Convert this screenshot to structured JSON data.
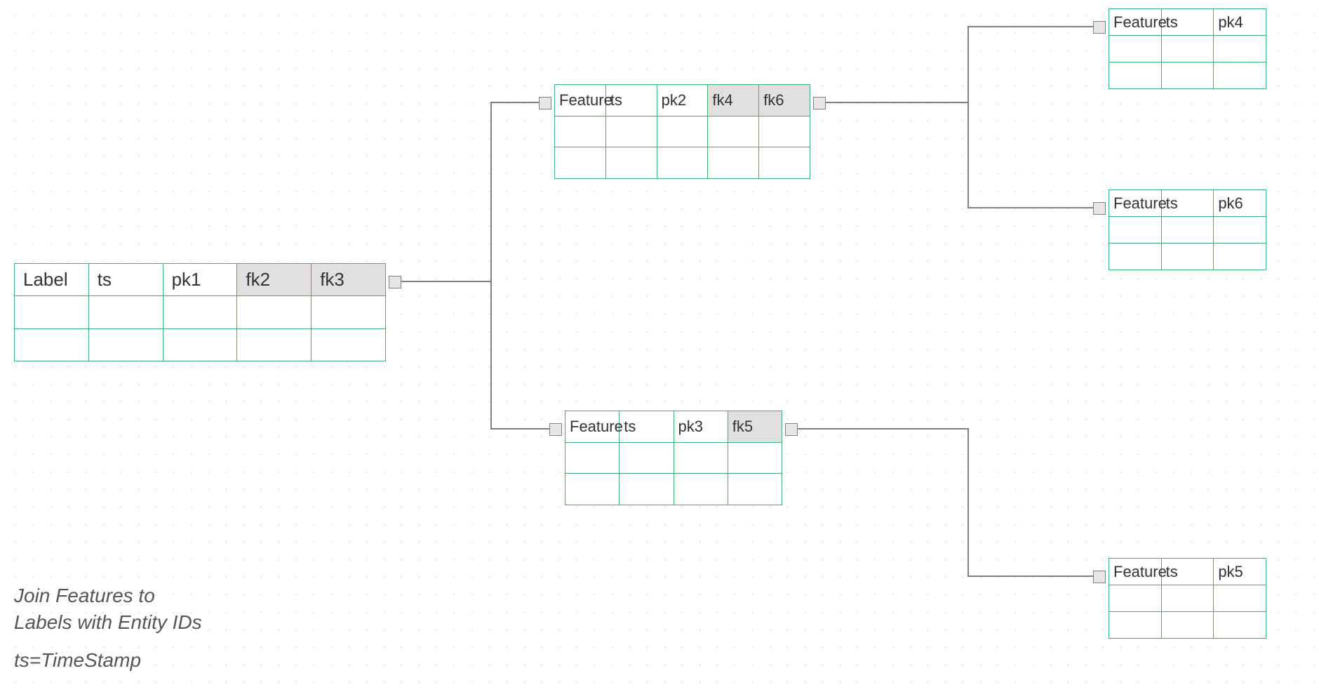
{
  "caption": "Join Features to\nLabels with Entity IDs",
  "footnote": "ts=TimeStamp",
  "nodes": [
    {
      "headers": [
        {
          "t": "Label"
        },
        {
          "t": "ts"
        },
        {
          "t": "pk1"
        },
        {
          "t": "fk2",
          "hl": true
        },
        {
          "t": "fk3",
          "hl": true
        }
      ]
    },
    {
      "headers": [
        {
          "t": "Feature"
        },
        {
          "t": "ts"
        },
        {
          "t": "pk2"
        },
        {
          "t": "fk4",
          "hl": true
        },
        {
          "t": "fk6",
          "hl": true
        }
      ]
    },
    {
      "headers": [
        {
          "t": "Feature"
        },
        {
          "t": "ts"
        },
        {
          "t": "pk3"
        },
        {
          "t": "fk5",
          "hl": true
        }
      ]
    },
    {
      "headers": [
        {
          "t": "Feature"
        },
        {
          "t": "ts"
        },
        {
          "t": "pk4"
        }
      ]
    },
    {
      "headers": [
        {
          "t": "Feature"
        },
        {
          "t": "ts"
        },
        {
          "t": "pk6"
        }
      ]
    },
    {
      "headers": [
        {
          "t": "Feature"
        },
        {
          "t": "ts"
        },
        {
          "t": "pk5"
        }
      ]
    }
  ]
}
